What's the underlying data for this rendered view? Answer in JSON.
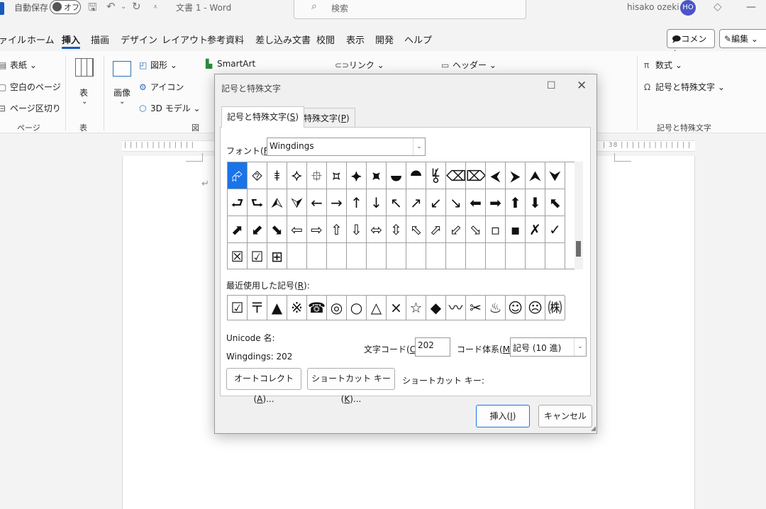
{
  "titlebar": {
    "autosave_label": "自動保存",
    "autosave_state": "オフ",
    "doc_title": "文書 1  -  Word",
    "search_placeholder": "検索",
    "user_name": "hisako ozeki",
    "avatar_initials": "HO"
  },
  "ribbon_tabs": [
    "ァイル",
    "ホーム",
    "挿入",
    "描画",
    "デザイン",
    "レイアウト",
    "参考資料",
    "差し込み文書",
    "校閲",
    "表示",
    "開発",
    "ヘルプ"
  ],
  "active_tab": "挿入",
  "header_buttons": {
    "comment": "コメント",
    "edit": "編集"
  },
  "ribbon": {
    "pages": {
      "cover": "表紙",
      "blank": "空白のページ",
      "break": "ページ区切り",
      "group": "ページ"
    },
    "table": {
      "label": "表",
      "group": "表"
    },
    "illustrations": {
      "picture": "画像",
      "shapes": "図形",
      "icons": "アイコン",
      "models3d": "3D モデル",
      "smartart": "SmartArt",
      "group": "図"
    },
    "links": {
      "link": "リンク"
    },
    "header_footer": {
      "header": "ヘッダー"
    },
    "symbols": {
      "equation": "数式",
      "symbol": "記号と特殊文字",
      "group": "記号と特殊文字"
    }
  },
  "ruler": {
    "right_marker": "38"
  },
  "dialog": {
    "title": "記号と特殊文字",
    "tab_symbols": "記号と特殊文字(",
    "tab_symbols_key": "S",
    "tab_special": "特殊文字(",
    "tab_special_key": "P",
    "font_label": "フォント(",
    "font_key": "F",
    "font_value": "Wingdings",
    "symbols": [
      [
        "⮳",
        "⯑",
        "⯒",
        "⯎",
        "⯐",
        "⯏",
        "⯌",
        "⯍",
        "⯋",
        "⯊",
        "⯉",
        "⌫",
        "⌦",
        "⮜",
        "⮞",
        "⮝",
        "⮟"
      ],
      [
        "⮐",
        "⮑",
        "⮙",
        "⮛",
        "←",
        "→",
        "↑",
        "↓",
        "↖",
        "↗",
        "↙",
        "↘",
        "⬅",
        "➡",
        "⬆",
        "⬇",
        "⬉"
      ],
      [
        "⬈",
        "⬋",
        "⬊",
        "⇦",
        "⇨",
        "⇧",
        "⇩",
        "⬄",
        "⇳",
        "⬁",
        "⬀",
        "⬃",
        "⬂",
        "▫",
        "▪",
        "✗",
        "✓"
      ],
      [
        "☒",
        "☑",
        "⊞",
        "",
        "",
        "",
        "",
        "",
        "",
        "",
        "",
        "",
        "",
        "",
        "",
        "",
        ""
      ]
    ],
    "recent_label": "最近使用した記号(",
    "recent_key": "R",
    "recent_symbols": [
      "☑",
      "〒",
      "▲",
      "※",
      "☎",
      "◎",
      "○",
      "△",
      "×",
      "☆",
      "◆",
      "〰",
      "✂",
      "♨",
      "☺",
      "☹",
      "㈱"
    ],
    "unicode_name_label": "Unicode 名:",
    "char_name": "Wingdings: 202",
    "char_code_label": "文字コード(",
    "char_code_key": "C",
    "char_code_value": "202",
    "code_system_label": "コード体系(",
    "code_system_key": "M",
    "code_system_value": "記号 (10 進)",
    "autocorrect_label": "オートコレクト(",
    "autocorrect_key": "A",
    "shortcut_key_button": "ショートカット キー(",
    "shortcut_key_key": "K",
    "shortcut_key_label": "ショートカット キー:",
    "insert_label": "挿入(",
    "insert_key": "I",
    "cancel_label": "キャンセル"
  },
  "colors": {
    "accent": "#185abd",
    "selection": "#1a73e8",
    "arrow": "#e3261d"
  }
}
